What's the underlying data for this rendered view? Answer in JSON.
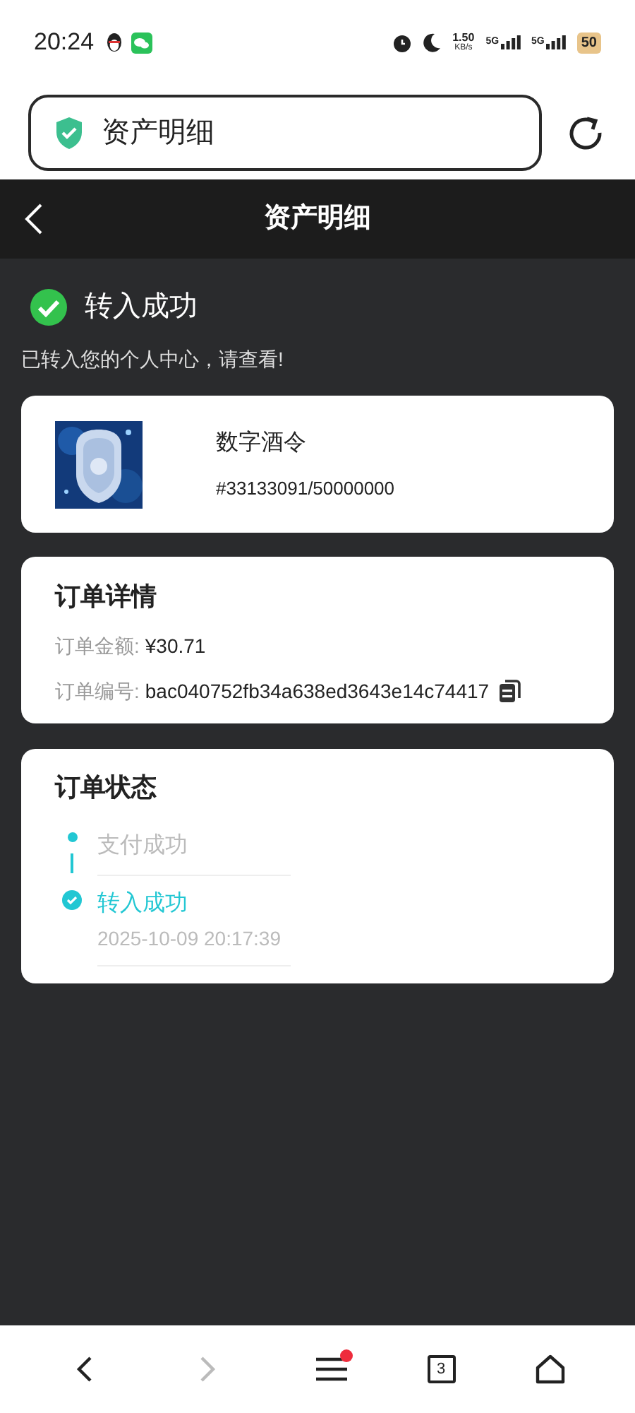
{
  "status_bar": {
    "time": "20:24",
    "speed_value": "1.50",
    "speed_unit": "KB/s",
    "signals": [
      "5G",
      "5G"
    ],
    "battery": "50"
  },
  "address_bar": {
    "title": "资产明细"
  },
  "header": {
    "title": "资产明细"
  },
  "result": {
    "title": "转入成功",
    "message": "已转入您的个人中心，请查看!"
  },
  "asset": {
    "name": "数字酒令",
    "serial": "#33133091/50000000"
  },
  "order_details": {
    "title": "订单详情",
    "fields": [
      {
        "label": "订单金额:",
        "value": "¥30.71",
        "copyable": false
      },
      {
        "label": "订单编号:",
        "value": "bac040752fb34a638ed3643e14c74417",
        "copyable": true
      }
    ]
  },
  "order_status": {
    "title": "订单状态",
    "steps": [
      {
        "label": "支付成功",
        "active": false
      },
      {
        "label": "转入成功",
        "time": "2025-10-09 20:17:39",
        "active": true
      }
    ]
  },
  "bottom_nav": {
    "tab_count": "3",
    "menu_badge": true
  }
}
